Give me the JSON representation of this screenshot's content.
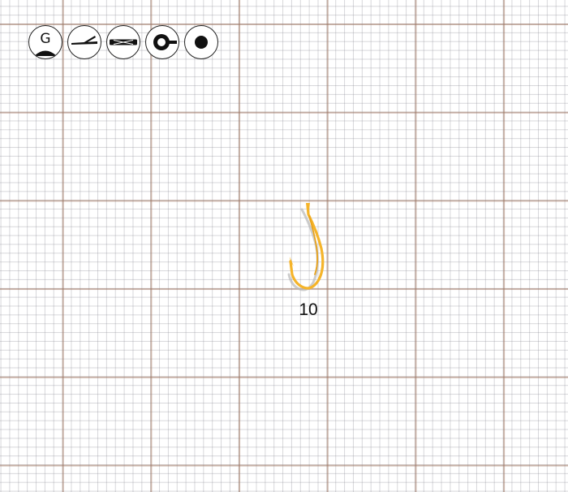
{
  "toolbar": {
    "buttons": [
      {
        "id": "g",
        "label": "G",
        "icon": "g-logo-icon"
      },
      {
        "id": "barb",
        "icon": "barbed-point-icon"
      },
      {
        "id": "shank",
        "icon": "straight-shank-icon"
      },
      {
        "id": "ring-eye",
        "icon": "ring-eye-icon"
      },
      {
        "id": "dot",
        "icon": "dot-icon"
      }
    ]
  },
  "hook": {
    "size_label": "10",
    "color": "#F5B42A",
    "icon": "fishing-hook-icon"
  },
  "grid": {
    "paper": "graph-paper",
    "major_line_color": "#B89A88",
    "minor_line_color": "#C8C8D0"
  }
}
